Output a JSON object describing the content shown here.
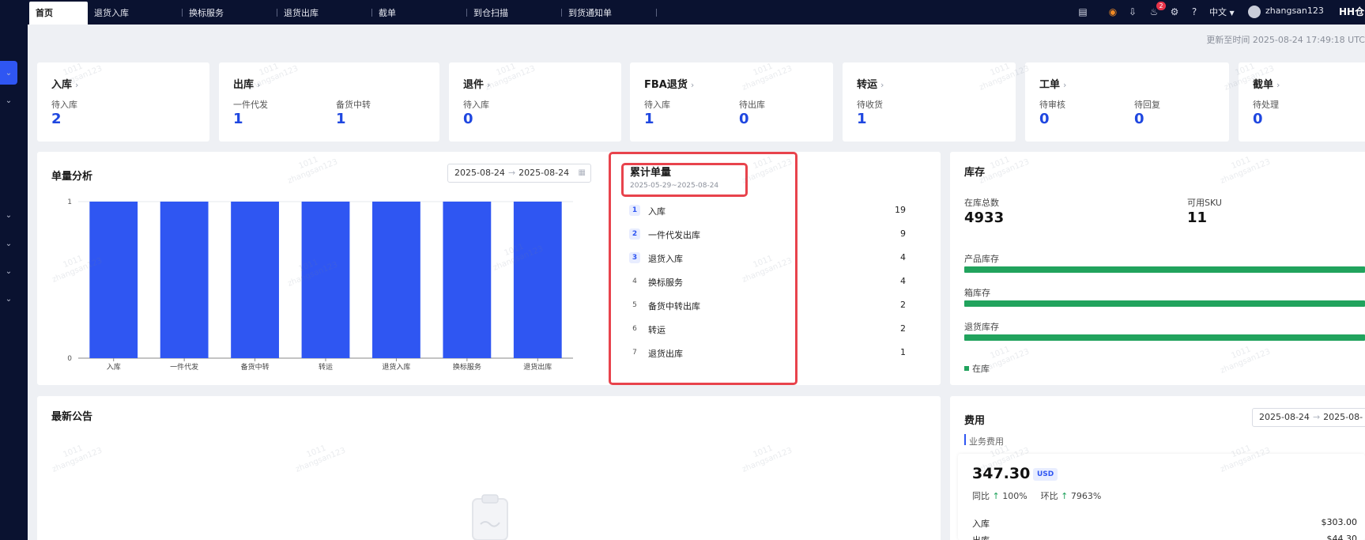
{
  "tabs": [
    {
      "label": "首页",
      "active": true
    },
    {
      "label": "退货入库"
    },
    {
      "label": "换标服务"
    },
    {
      "label": "退货出库"
    },
    {
      "label": "截单"
    },
    {
      "label": "到仓扫描"
    },
    {
      "label": "到货通知单"
    }
  ],
  "header": {
    "notification_count": "2",
    "language": "中文",
    "username": "zhangsan123",
    "brand": "HH仓"
  },
  "updated_text": "更新至时间 2025-08-24 17:49:18 UTC",
  "summary": {
    "inbound": {
      "title": "入库",
      "items": [
        {
          "label": "待入库",
          "value": "2"
        }
      ]
    },
    "outbound": {
      "title": "出库",
      "items": [
        {
          "label": "一件代发",
          "value": "1"
        },
        {
          "label": "备货中转",
          "value": "1"
        }
      ]
    },
    "returns": {
      "title": "退件",
      "items": [
        {
          "label": "待入库",
          "value": "0"
        }
      ]
    },
    "fba": {
      "title": "FBA退货",
      "items": [
        {
          "label": "待入库",
          "value": "1"
        },
        {
          "label": "待出库",
          "value": "0"
        }
      ]
    },
    "transfer": {
      "title": "转运",
      "items": [
        {
          "label": "待收货",
          "value": "1"
        }
      ]
    },
    "workorder": {
      "title": "工单",
      "items": [
        {
          "label": "待审核",
          "value": "0"
        },
        {
          "label": "待回复",
          "value": "0"
        }
      ]
    },
    "intercept": {
      "title": "截单",
      "items": [
        {
          "label": "待处理",
          "value": "0"
        }
      ]
    }
  },
  "order_analysis": {
    "title": "单量分析",
    "date_from": "2025-08-24",
    "date_to": "2025-08-24"
  },
  "chart_data": {
    "type": "bar",
    "categories": [
      "入库",
      "一件代发",
      "备货中转",
      "转运",
      "退货入库",
      "换标服务",
      "退货出库"
    ],
    "values": [
      1,
      1,
      1,
      1,
      1,
      1,
      1
    ],
    "ylim": [
      0,
      1
    ],
    "yticks": [
      "0",
      "1"
    ],
    "color": "#2f56f2",
    "grid": true
  },
  "cumulative": {
    "title": "累计单量",
    "range": "2025-05-29~2025-08-24",
    "items": [
      {
        "rank": "1",
        "name": "入库",
        "value": "19"
      },
      {
        "rank": "2",
        "name": "一件代发出库",
        "value": "9"
      },
      {
        "rank": "3",
        "name": "退货入库",
        "value": "4"
      },
      {
        "rank": "4",
        "name": "换标服务",
        "value": "4"
      },
      {
        "rank": "5",
        "name": "备货中转出库",
        "value": "2"
      },
      {
        "rank": "6",
        "name": "转运",
        "value": "2"
      },
      {
        "rank": "7",
        "name": "退货出库",
        "value": "1"
      }
    ]
  },
  "inventory": {
    "title": "库存",
    "total_label": "在库总数",
    "total_value": "4933",
    "sku_label": "可用SKU",
    "sku_value": "11",
    "bars": [
      {
        "label": "产品库存"
      },
      {
        "label": "箱库存"
      },
      {
        "label": "退货库存"
      }
    ],
    "legend": "在库",
    "accent": "#21a35d"
  },
  "notices": {
    "title": "最新公告"
  },
  "fees": {
    "title": "费用",
    "subtitle": "业务费用",
    "date_from": "2025-08-24",
    "date_to": "2025-08-",
    "amount": "347.30",
    "currency": "USD",
    "yoy_label": "同比",
    "yoy_value": "100%",
    "mom_label": "环比",
    "mom_value": "7963%",
    "rows": [
      {
        "label": "入库",
        "value": "$303.00"
      },
      {
        "label": "出库",
        "value": "$44.30"
      }
    ]
  },
  "watermark": {
    "line1": "1011",
    "line2": "zhangsan123"
  }
}
